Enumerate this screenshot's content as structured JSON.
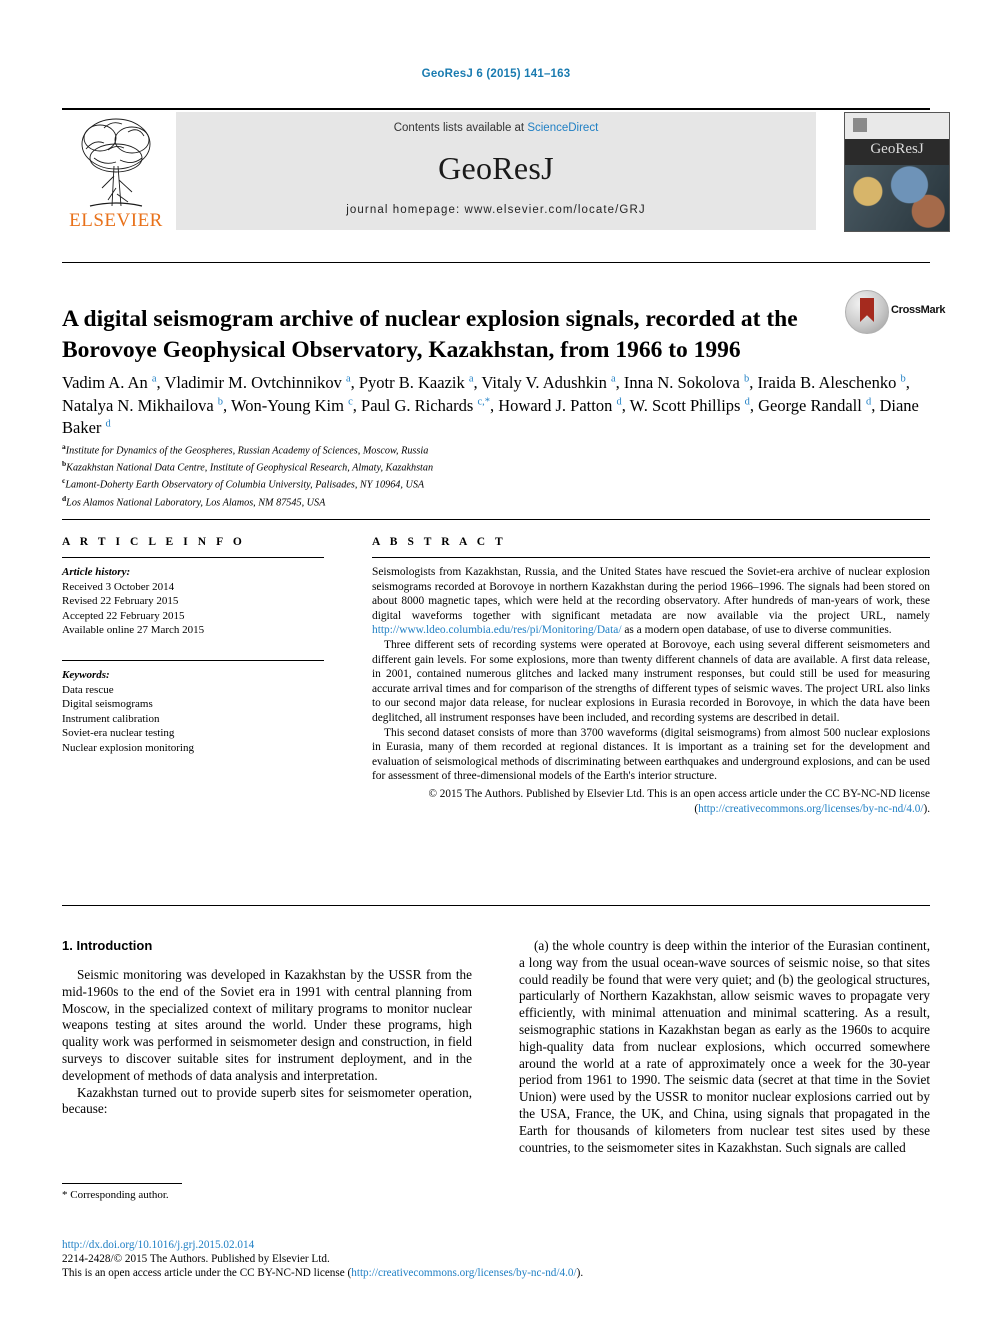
{
  "running_head": "GeoResJ 6 (2015) 141–163",
  "masthead": {
    "publisher_name": "ELSEVIER",
    "contents_prefix": "Contents lists available at ",
    "contents_link": "ScienceDirect",
    "journal_title": "GeoResJ",
    "homepage": "journal homepage: www.elsevier.com/locate/GRJ",
    "cover_title": "GeoResJ"
  },
  "article": {
    "title": "A digital seismogram archive of nuclear explosion signals, recorded at the Borovoye Geophysical Observatory, Kazakhstan, from 1966 to 1996",
    "crossmark_label": "CrossMark",
    "authors_html": "Vadim A. An <sup>a</sup>, Vladimir M. Ovtchinnikov <sup>a</sup>, Pyotr B. Kaazik <sup>a</sup>, Vitaly V. Adushkin <sup>a</sup>, Inna N. Sokolova <sup>b</sup>, Iraida B. Aleschenko <sup>b</sup>, Natalya N. Mikhailova <sup>b</sup>, Won-Young Kim <sup>c</sup>, Paul G. Richards <sup>c,</sup><sup>*</sup>, Howard J. Patton <sup>d</sup>, W. Scott Phillips <sup>d</sup>, George Randall <sup>d</sup>, Diane Baker <sup>d</sup>",
    "affiliations": [
      {
        "mark": "a",
        "text": "Institute for Dynamics of the Geospheres, Russian Academy of Sciences, Moscow, Russia"
      },
      {
        "mark": "b",
        "text": "Kazakhstan National Data Centre, Institute of Geophysical Research, Almaty, Kazakhstan"
      },
      {
        "mark": "c",
        "text": "Lamont-Doherty Earth Observatory of Columbia University, Palisades, NY 10964, USA"
      },
      {
        "mark": "d",
        "text": "Los Alamos National Laboratory, Los Alamos, NM 87545, USA"
      }
    ]
  },
  "article_info": {
    "heading": "A R T I C L E  I N F O",
    "history_label": "Article history:",
    "history": [
      "Received 3 October 2014",
      "Revised 22 February 2015",
      "Accepted 22 February 2015",
      "Available online 27 March 2015"
    ],
    "keywords_label": "Keywords:",
    "keywords": [
      "Data rescue",
      "Digital seismograms",
      "Instrument calibration",
      "Soviet-era nuclear testing",
      "Nuclear explosion monitoring"
    ]
  },
  "abstract": {
    "heading": "A B S T R A C T",
    "paragraph_1_before_link": "Seismologists from Kazakhstan, Russia, and the United States have rescued the Soviet-era archive of nuclear explosion seismograms recorded at Borovoye in northern Kazakhstan during the period 1966–1996. The signals had been stored on about 8000 magnetic tapes, which were held at the recording observatory. After hundreds of man-years of work, these digital waveforms together with significant metadata are now available via the project URL, namely ",
    "paragraph_1_link": "http://www.ldeo.columbia.edu/res/pi/Monitoring/Data/",
    "paragraph_1_after_link": " as a modern open database, of use to diverse communities.",
    "paragraph_2": "Three different sets of recording systems were operated at Borovoye, each using several different seismometers and different gain levels. For some explosions, more than twenty different channels of data are available. A first data release, in 2001, contained numerous glitches and lacked many instrument responses, but could still be used for measuring accurate arrival times and for comparison of the strengths of different types of seismic waves. The project URL also links to our second major data release, for nuclear explosions in Eurasia recorded in Borovoye, in which the data have been deglitched, all instrument responses have been included, and recording systems are described in detail.",
    "paragraph_3": "This second dataset consists of more than 3700 waveforms (digital seismograms) from almost 500 nuclear explosions in Eurasia, many of them recorded at regional distances. It is important as a training set for the development and evaluation of seismological methods of discriminating between earthquakes and underground explosions, and can be used for assessment of three-dimensional models of the Earth's interior structure.",
    "copyright_text": "© 2015 The Authors. Published by Elsevier Ltd. This is an open access article under the CC BY-NC-ND license",
    "copyright_link_open": "(",
    "copyright_link": "http://creativecommons.org/licenses/by-nc-nd/4.0/",
    "copyright_link_close": ")."
  },
  "body": {
    "section_heading": "1. Introduction",
    "left_paragraph_1": "Seismic monitoring was developed in Kazakhstan by the USSR from the mid-1960s to the end of the Soviet era in 1991 with central planning from Moscow, in the specialized context of military programs to monitor nuclear weapons testing at sites around the world. Under these programs, high quality work was performed in seismometer design and construction, in field surveys to discover suitable sites for instrument deployment, and in the development of methods of data analysis and interpretation.",
    "left_paragraph_2": "Kazakhstan turned out to provide superb sites for seismometer operation, because:",
    "right_paragraph_1": "(a) the whole country is deep within the interior of the Eurasian continent, a long way from the usual ocean-wave sources of seismic noise, so that sites could readily be found that were very quiet; and (b) the geological structures, particularly of Northern Kazakhstan, allow seismic waves to propagate very efficiently, with minimal attenuation and minimal scattering. As a result, seismographic stations in Kazakhstan began as early as the 1960s to acquire high-quality data from nuclear explosions, which occurred somewhere around the world at a rate of approximately once a week for the 30-year period from 1961 to 1990. The seismic data (secret at that time in the Soviet Union) were used by the USSR to monitor nuclear explosions carried out by the USA, France, the UK, and China, using signals that propagated in the Earth for thousands of kilometers from nuclear test sites used by these countries, to the seismometer sites in Kazakhstan. Such signals are called"
  },
  "footer": {
    "corresponding_mark": "*",
    "corresponding_text": "Corresponding author.",
    "doi": "http://dx.doi.org/10.1016/j.grj.2015.02.014",
    "issn_line": "2214-2428/© 2015 The Authors. Published by Elsevier Ltd.",
    "license_prefix": "This is an open access article under the CC BY-NC-ND license (",
    "license_link": "http://creativecommons.org/licenses/by-nc-nd/4.0/",
    "license_suffix": ")."
  },
  "colors": {
    "link": "#1f7fc4",
    "running_head": "#1a7bb0",
    "elsevier_orange": "#E8711A",
    "band_gray": "#e6e6e6"
  }
}
